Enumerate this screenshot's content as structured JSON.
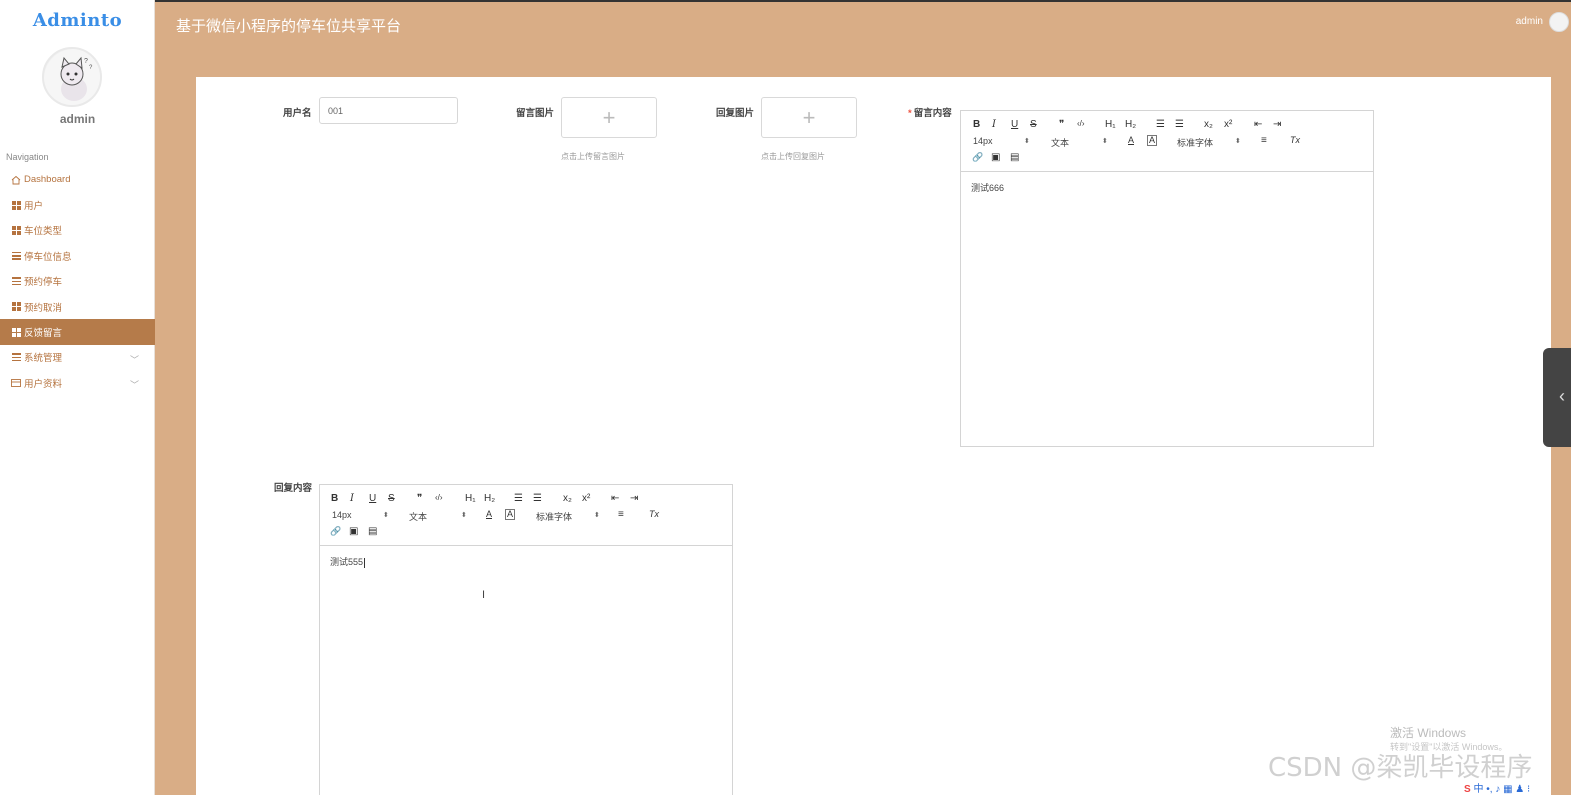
{
  "app": {
    "logo": "Adminto",
    "title": "基于微信小程序的停车位共享平台",
    "user": "admin"
  },
  "sidebar": {
    "username": "admin",
    "heading": "Navigation",
    "items": [
      {
        "label": "Dashboard",
        "icon": "home-icon"
      },
      {
        "label": "用户",
        "icon": "grid-icon"
      },
      {
        "label": "车位类型",
        "icon": "grid-icon"
      },
      {
        "label": "停车位信息",
        "icon": "list-icon"
      },
      {
        "label": "预约停车",
        "icon": "list-icon"
      },
      {
        "label": "预约取消",
        "icon": "grid-icon"
      },
      {
        "label": "反馈留言",
        "icon": "grid-icon",
        "active": true
      },
      {
        "label": "系统管理",
        "icon": "list-icon",
        "expandable": true
      },
      {
        "label": "用户资料",
        "icon": "card-icon",
        "expandable": true
      }
    ]
  },
  "form": {
    "username_label": "用户名",
    "username_value": "001",
    "message_image_label": "留言图片",
    "message_image_hint": "点击上传留言图片",
    "reply_image_label": "回复图片",
    "reply_image_hint": "点击上传回复图片",
    "message_content_label": "留言内容",
    "message_content_value": "测试666",
    "reply_content_label": "回复内容",
    "reply_content_value": "测试555"
  },
  "editor_toolbar": {
    "bold": "B",
    "italic": "I",
    "underline": "U",
    "strike": "S",
    "quote": "❞",
    "code": "‹/›",
    "h1": "H₁",
    "h2": "H₂",
    "ol": "☰",
    "ul": "☰",
    "sub": "x₂",
    "sup": "x²",
    "outdent": "⇤",
    "indent": "⇥",
    "size": "14px",
    "header": "文本",
    "color": "A",
    "bg": "A",
    "font": "标准字体",
    "align": "≡",
    "clean": "Tx",
    "link": "🔗",
    "image": "▣",
    "video": "▤"
  },
  "overlay": {
    "win_line1": "激活 Windows",
    "win_line2": "转到\"设置\"以激活 Windows。",
    "csdn": "CSDN @梁凯毕设程序"
  },
  "colors": {
    "header_bg": "#d9ad86",
    "active_nav": "#b57b4a",
    "nav_text": "#b5733f"
  }
}
